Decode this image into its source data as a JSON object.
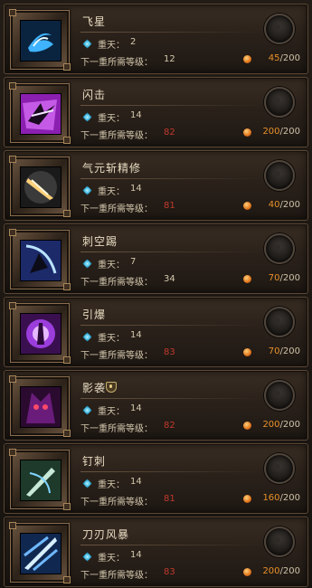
{
  "colors": {
    "gold_text": "#e8902a",
    "red_value": "#c0392b",
    "card_border": "#5b4736"
  },
  "labels": {
    "tier": "重天：",
    "next_req": "下一重所需等级："
  },
  "skills": [
    {
      "name": "飞星",
      "tier": "2",
      "req": "12",
      "req_red": false,
      "current": "45",
      "max": "/200",
      "icon": "swirl-icon"
    },
    {
      "name": "闪击",
      "tier": "14",
      "req": "82",
      "req_red": true,
      "current": "200",
      "max": "/200",
      "icon": "dash-strike-icon"
    },
    {
      "name": "气元斩精修",
      "tier": "14",
      "req": "81",
      "req_red": true,
      "current": "40",
      "max": "/200",
      "icon": "slash-orb-icon"
    },
    {
      "name": "刺空踢",
      "tier": "7",
      "req": "34",
      "req_red": false,
      "current": "70",
      "max": "/200",
      "icon": "kick-icon"
    },
    {
      "name": "引爆",
      "tier": "14",
      "req": "83",
      "req_red": true,
      "current": "70",
      "max": "/200",
      "icon": "detonate-icon"
    },
    {
      "name": "影袭",
      "tier": "14",
      "req": "82",
      "req_red": true,
      "current": "200",
      "max": "/200",
      "icon": "shadow-raid-icon",
      "badge": true
    },
    {
      "name": "钉刺",
      "tier": "14",
      "req": "81",
      "req_red": true,
      "current": "160",
      "max": "/200",
      "icon": "spike-icon"
    },
    {
      "name": "刀刃风暴",
      "tier": "14",
      "req": "83",
      "req_red": true,
      "current": "200",
      "max": "/200",
      "icon": "blade-storm-icon"
    }
  ]
}
